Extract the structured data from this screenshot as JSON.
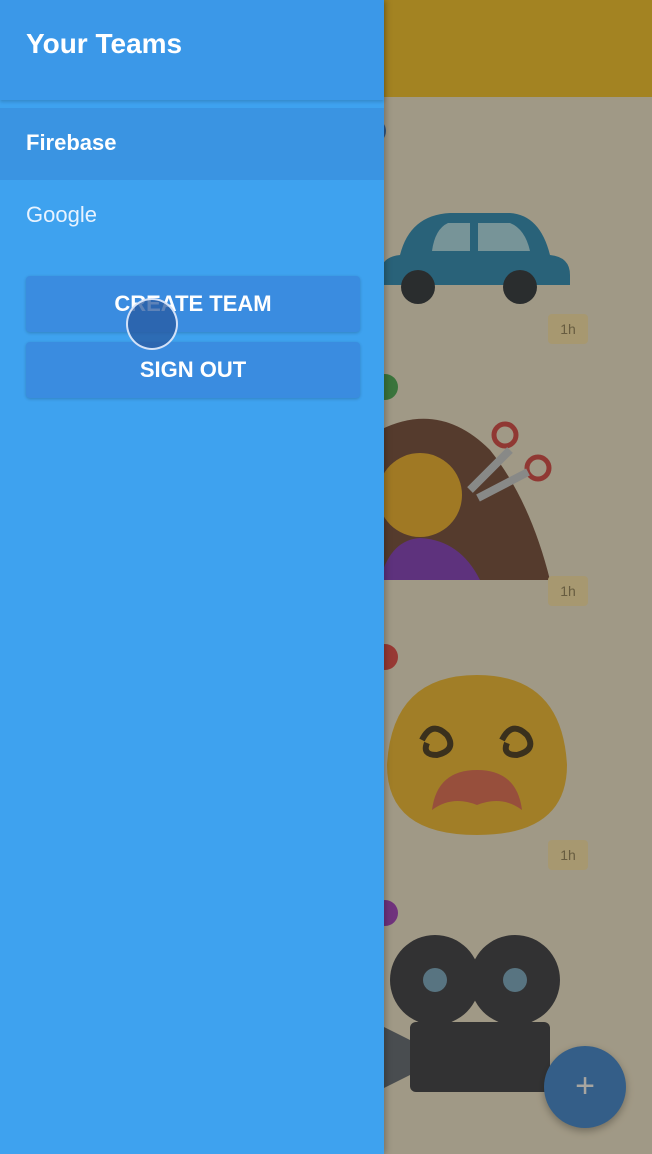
{
  "drawer": {
    "title": "Your Teams",
    "teams": [
      {
        "label": "Firebase",
        "active": true
      },
      {
        "label": "Google",
        "active": false
      }
    ],
    "create_team_label": "CREATE TEAM",
    "sign_out_label": "SIGN OUT"
  },
  "feed": {
    "posts": [
      {
        "emoji_icon": "car-icon",
        "time": "1h"
      },
      {
        "emoji_icon": "woman-getting-haircut-icon",
        "time": "1h"
      },
      {
        "emoji_icon": "dizzy-face-icon",
        "time": "1h"
      },
      {
        "emoji_icon": "movie-camera-icon",
        "time": ""
      }
    ],
    "fab_label": "+"
  },
  "colors": {
    "drawer_bg": "#3ea2ef",
    "button_bg": "#3a8ce0",
    "header_yellow": "#f7c21b",
    "fab_blue": "#2f7fd4"
  }
}
